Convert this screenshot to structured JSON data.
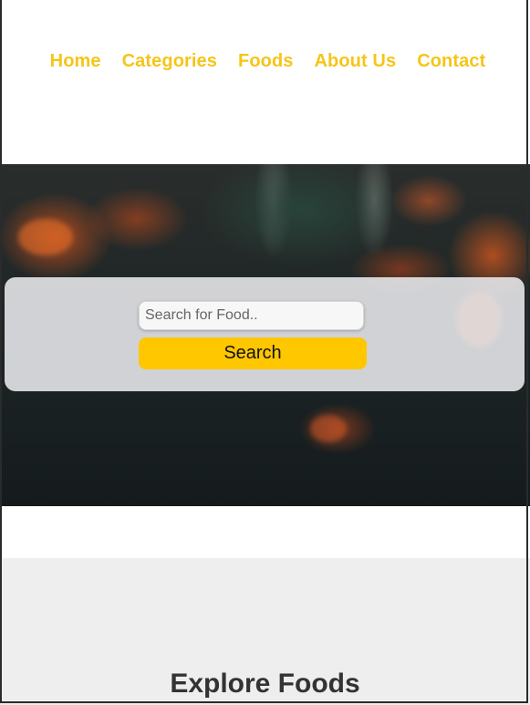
{
  "nav": {
    "items": [
      {
        "label": "Home"
      },
      {
        "label": "Categories"
      },
      {
        "label": "Foods"
      },
      {
        "label": "About Us"
      },
      {
        "label": "Contact"
      }
    ],
    "link_color": "#f5c518"
  },
  "search": {
    "placeholder": "Search for Food..",
    "value": "",
    "button_label": "Search",
    "button_color": "#ffc700"
  },
  "explore": {
    "title": "Explore Foods",
    "background": "#eeeeee"
  }
}
